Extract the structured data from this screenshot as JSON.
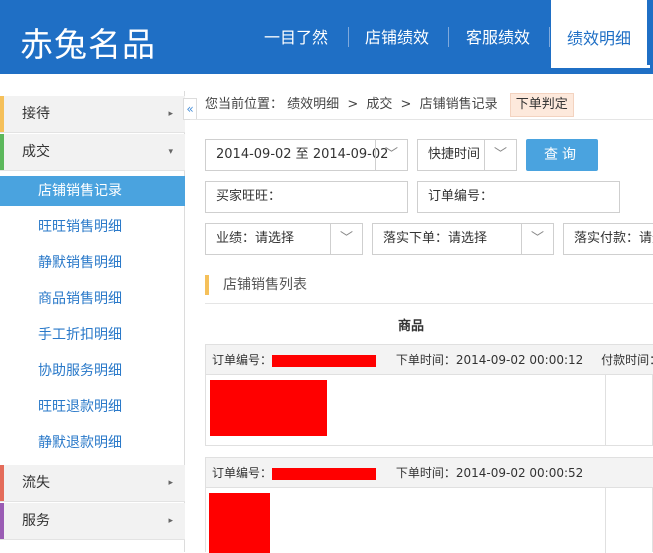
{
  "header": {
    "logo": "赤兔名品",
    "nav": [
      "一目了然",
      "店铺绩效",
      "客服绩效",
      "绩效明细"
    ],
    "active_nav": "绩效明细"
  },
  "sidebar": {
    "collapse_glyph": "«",
    "groups": [
      {
        "label": "接待",
        "color": "#f5c05a",
        "arrow": "▸"
      },
      {
        "label": "成交",
        "color": "#5cb85c",
        "arrow": "▾"
      },
      {
        "label": "流失",
        "color": "#e46c5a",
        "arrow": "▸"
      },
      {
        "label": "服务",
        "color": "#9a5cb4",
        "arrow": "▸"
      }
    ],
    "items": [
      "店铺销售记录",
      "旺旺销售明细",
      "静默销售明细",
      "商品销售明细",
      "手工折扣明细",
      "协助服务明细",
      "旺旺退款明细",
      "静默退款明细"
    ],
    "active_item": "店铺销售记录"
  },
  "breadcrumb": {
    "prefix": "您当前位置：",
    "parts": [
      "绩效明细",
      "成交",
      "店铺销售记录"
    ],
    "sep": ">",
    "tag": "下单判定"
  },
  "filters": {
    "date_range": "2014-09-02 至 2014-09-02",
    "quick_time": "快捷时间",
    "query_label": "查询",
    "buyer_label": "买家旺旺：",
    "order_label": "订单编号：",
    "perf_label": "业绩：请选择",
    "order_place_label": "落实下单：请选择",
    "pay_label": "落实付款：请选"
  },
  "list": {
    "title": "店铺销售列表",
    "column_goods": "商品",
    "orders": [
      {
        "order_no_label": "订单编号：",
        "order_time": "下单时间：2014-09-02 00:00:12",
        "pay_time": "付款时间：2"
      },
      {
        "order_no_label": "订单编号：",
        "order_time": "下单时间：2014-09-02 00:00:52",
        "pay_time": ""
      }
    ]
  },
  "icons": {
    "chevron_down": "﹀",
    "chevron_right": "▸"
  },
  "colors": {
    "header_bg": "#1f6fc5",
    "accent": "#4aa3df",
    "redacted": "#ff0000"
  }
}
